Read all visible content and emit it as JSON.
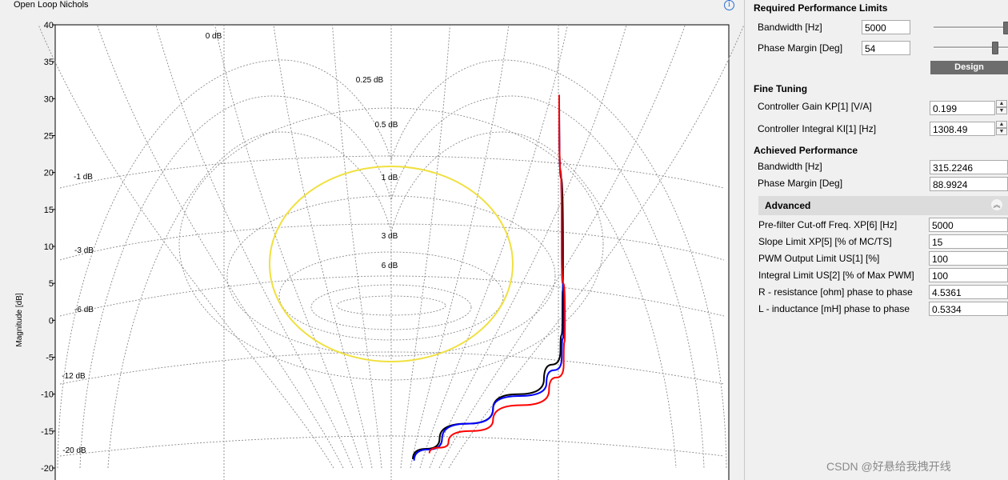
{
  "chart_panel": {
    "title": "Open Loop Nichols",
    "info_icon": "info-icon"
  },
  "chart_data": {
    "type": "line",
    "title": "Open Loop Nichols",
    "ylabel": "Magnitude [dB]",
    "xlabel": "",
    "ylim": [
      -20,
      40
    ],
    "yticks": [
      40,
      35,
      30,
      25,
      20,
      15,
      10,
      5,
      0,
      -5,
      -10,
      -15,
      -20
    ],
    "grid": true,
    "m_circles": [
      "0 dB",
      "0.25 dB",
      "0.5 dB",
      "1 dB",
      "3 dB",
      "6 dB",
      "-1 dB",
      "-3 dB",
      "-6 dB",
      "-12 dB",
      "-20 dB"
    ],
    "series": [
      {
        "color": "#000000",
        "points": [
          [
            -48,
            30.5
          ],
          [
            -45,
            8
          ],
          [
            -45.5,
            0
          ],
          [
            -47,
            -4
          ],
          [
            -60,
            -8
          ],
          [
            -100,
            -12
          ],
          [
            -142,
            -16
          ],
          [
            -163,
            -18.8
          ]
        ]
      },
      {
        "color": "#0000ff",
        "points": [
          [
            -48,
            30.5
          ],
          [
            -46,
            10
          ],
          [
            -44.5,
            0
          ],
          [
            -46,
            -5
          ],
          [
            -58,
            -8.5
          ],
          [
            -100,
            -12
          ],
          [
            -140,
            -16
          ],
          [
            -162,
            -19
          ]
        ]
      },
      {
        "color": "#ff0000",
        "points": [
          [
            -48,
            30.5
          ],
          [
            -46,
            10
          ],
          [
            -43.5,
            0
          ],
          [
            -44.5,
            -6
          ],
          [
            -56,
            -9.5
          ],
          [
            -100,
            -13.5
          ],
          [
            -135,
            -16.5
          ],
          [
            -150,
            -18
          ]
        ]
      }
    ]
  },
  "side": {
    "required_title": "Required Performance Limits",
    "bandwidth_label": "Bandwidth [Hz]",
    "bandwidth_value": "5000",
    "phase_margin_label": "Phase Margin [Deg]",
    "phase_margin_value": "54",
    "bandwidth_slider": 1.0,
    "phase_margin_slider": 0.85,
    "design_label": "Design",
    "fine_title": "Fine Tuning",
    "kp_label": "Controller Gain KP[1] [V/A]",
    "kp_value": "0.199",
    "ki_label": "Controller Integral KI[1] [Hz]",
    "ki_value": "1308.49",
    "achieved_title": "Achieved Performance",
    "ach_bw_label": "Bandwidth [Hz]",
    "ach_bw_value": "315.2246",
    "ach_pm_label": "Phase Margin [Deg]",
    "ach_pm_value": "88.9924",
    "advanced_title": "Advanced",
    "advanced_rows": [
      {
        "label": "Pre-filter Cut-off Freq. XP[6] [Hz]",
        "value": "5000"
      },
      {
        "label": "Slope Limit XP[5] [% of MC/TS]",
        "value": "15"
      },
      {
        "label": "PWM Output Limit US[1] [%]",
        "value": "100"
      },
      {
        "label": "Integral Limit US[2] [% of Max PWM]",
        "value": "100"
      },
      {
        "label": "R - resistance [ohm] phase to phase",
        "value": "4.5361"
      },
      {
        "label": "L - inductance [mH] phase to phase",
        "value": "0.5334"
      }
    ]
  },
  "watermark": "CSDN @好悬给我拽开线"
}
